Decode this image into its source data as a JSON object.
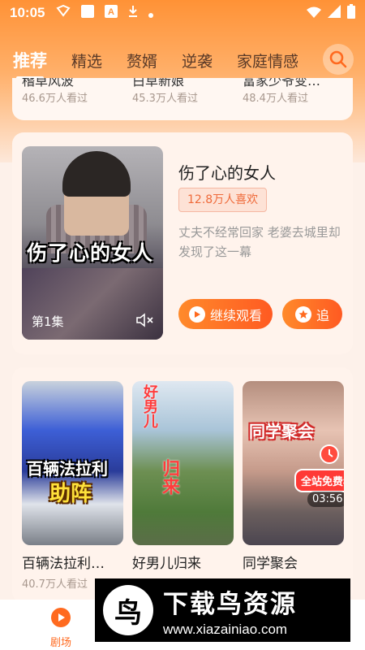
{
  "status_bar": {
    "time": "10:05"
  },
  "tabs": [
    {
      "label": "推荐",
      "active": true
    },
    {
      "label": "精选",
      "active": false
    },
    {
      "label": "赘婿",
      "active": false
    },
    {
      "label": "逆袭",
      "active": false
    },
    {
      "label": "家庭情感",
      "active": false
    }
  ],
  "prev_row": [
    {
      "title": "稽草风波",
      "views": "46.6万人看过"
    },
    {
      "title": "白草新娘",
      "views": "45.3万人看过"
    },
    {
      "title": "富家少爷变…",
      "views": "48.4万人看过"
    }
  ],
  "featured": {
    "title": "伤了心的女人",
    "poster_text": "伤了心的女人",
    "episode": "第1集",
    "likes": "12.8万人喜欢",
    "description": "丈夫不经常回家 老婆去城里却发现了这一幕",
    "continue_label": "继续观看",
    "follow_label": "追"
  },
  "dramas": [
    {
      "name": "百辆法拉利…",
      "views": "40.7万人看过",
      "overlay1": "百辆法拉利",
      "overlay2": "助阵"
    },
    {
      "name": "好男儿归来",
      "views": "",
      "overlay1": "好男儿",
      "overlay2": "归来"
    },
    {
      "name": "同学聚会",
      "views": "",
      "overlay1": "同学聚会",
      "free_badge": "全站免费看",
      "duration": "03:56"
    }
  ],
  "bottom_nav": {
    "theater_label": "剧场"
  },
  "watermark": {
    "cn": "下载鸟资源",
    "url": "www.xiazainiao.com",
    "logo_char": "鸟"
  },
  "colors": {
    "accent": "#ff6a1f",
    "gradient_top": "#ff9236"
  }
}
